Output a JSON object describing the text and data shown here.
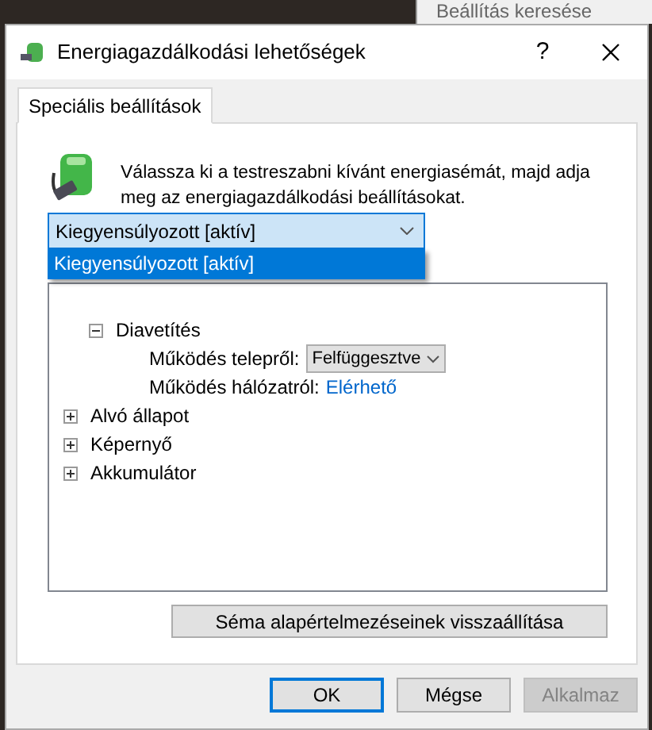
{
  "background": {
    "search_field": {
      "placeholder": "Beállítás keresése"
    }
  },
  "window": {
    "title": "Energiagazdálkodási lehetőségek",
    "help": "?"
  },
  "tabs": [
    {
      "label": "Speciális beállítások",
      "selected": true
    }
  ],
  "instruction": "Válassza ki a testreszabni kívánt energiasémát, majd adja meg az energiagazdálkodási beállításokat.",
  "plan_select": {
    "value": "Kiegyensúlyozott [aktív]",
    "expanded": true,
    "options": [
      {
        "label": "Kiegyensúlyozott [aktív]",
        "selected": true
      }
    ]
  },
  "tree": [
    {
      "label": "Diavetítés",
      "expanded": true,
      "children": [
        {
          "label": "Működés telepről:",
          "kind": "select",
          "value": "Felfüggesztve"
        },
        {
          "label": "Működés hálózatról:",
          "kind": "link",
          "value": "Elérhető"
        }
      ]
    },
    {
      "label": "Alvó állapot",
      "expanded": false
    },
    {
      "label": "Képernyő",
      "expanded": false
    },
    {
      "label": "Akkumulátor",
      "expanded": false
    }
  ],
  "reset_button": "Séma alapértelmezéseinek visszaállítása",
  "buttons": [
    {
      "label": "OK",
      "default": true,
      "disabled": false
    },
    {
      "label": "Mégse",
      "default": false,
      "disabled": false
    },
    {
      "label": "Alkalmaz",
      "default": false,
      "disabled": true
    }
  ]
}
